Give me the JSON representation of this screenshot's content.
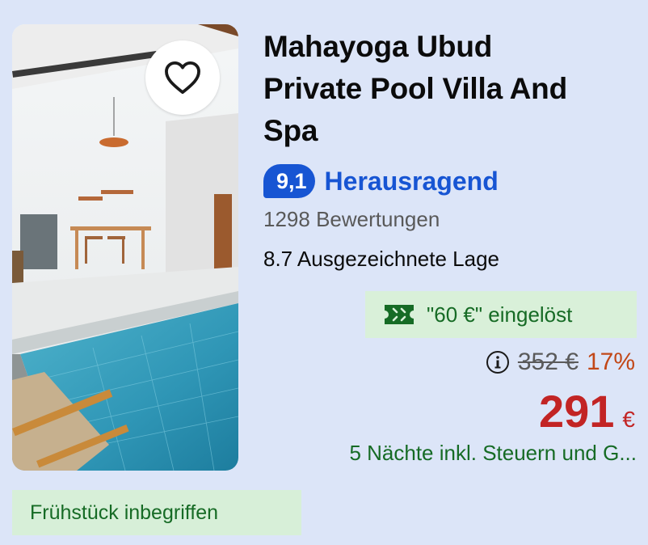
{
  "hotel": {
    "title_lines": [
      "Mahayoga Ubud",
      "Private Pool Villa And",
      "Spa"
    ],
    "rating": {
      "score": "9,1",
      "label": "Herausragend",
      "reviews": "1298 Bewertungen",
      "location": "8.7 Ausgezeichnete Lage"
    },
    "coupon": {
      "icon": "coupon-ticket-icon",
      "text": "\"60 €\" eingelöst"
    },
    "pricing": {
      "info_icon": "info-icon",
      "old_price": "352 €",
      "discount": "17%",
      "price": "291",
      "currency": "€",
      "note": "5 Nächte inkl. Steuern und G..."
    },
    "breakfast": "Frühstück inbegriffen",
    "favorite_icon": "heart-icon"
  },
  "colors": {
    "background": "#dce5f8",
    "brand_blue": "#1755d3",
    "green_text": "#166b25",
    "green_bg": "#d9f0d9",
    "price_red": "#c22424",
    "discount_orange": "#c24717"
  }
}
